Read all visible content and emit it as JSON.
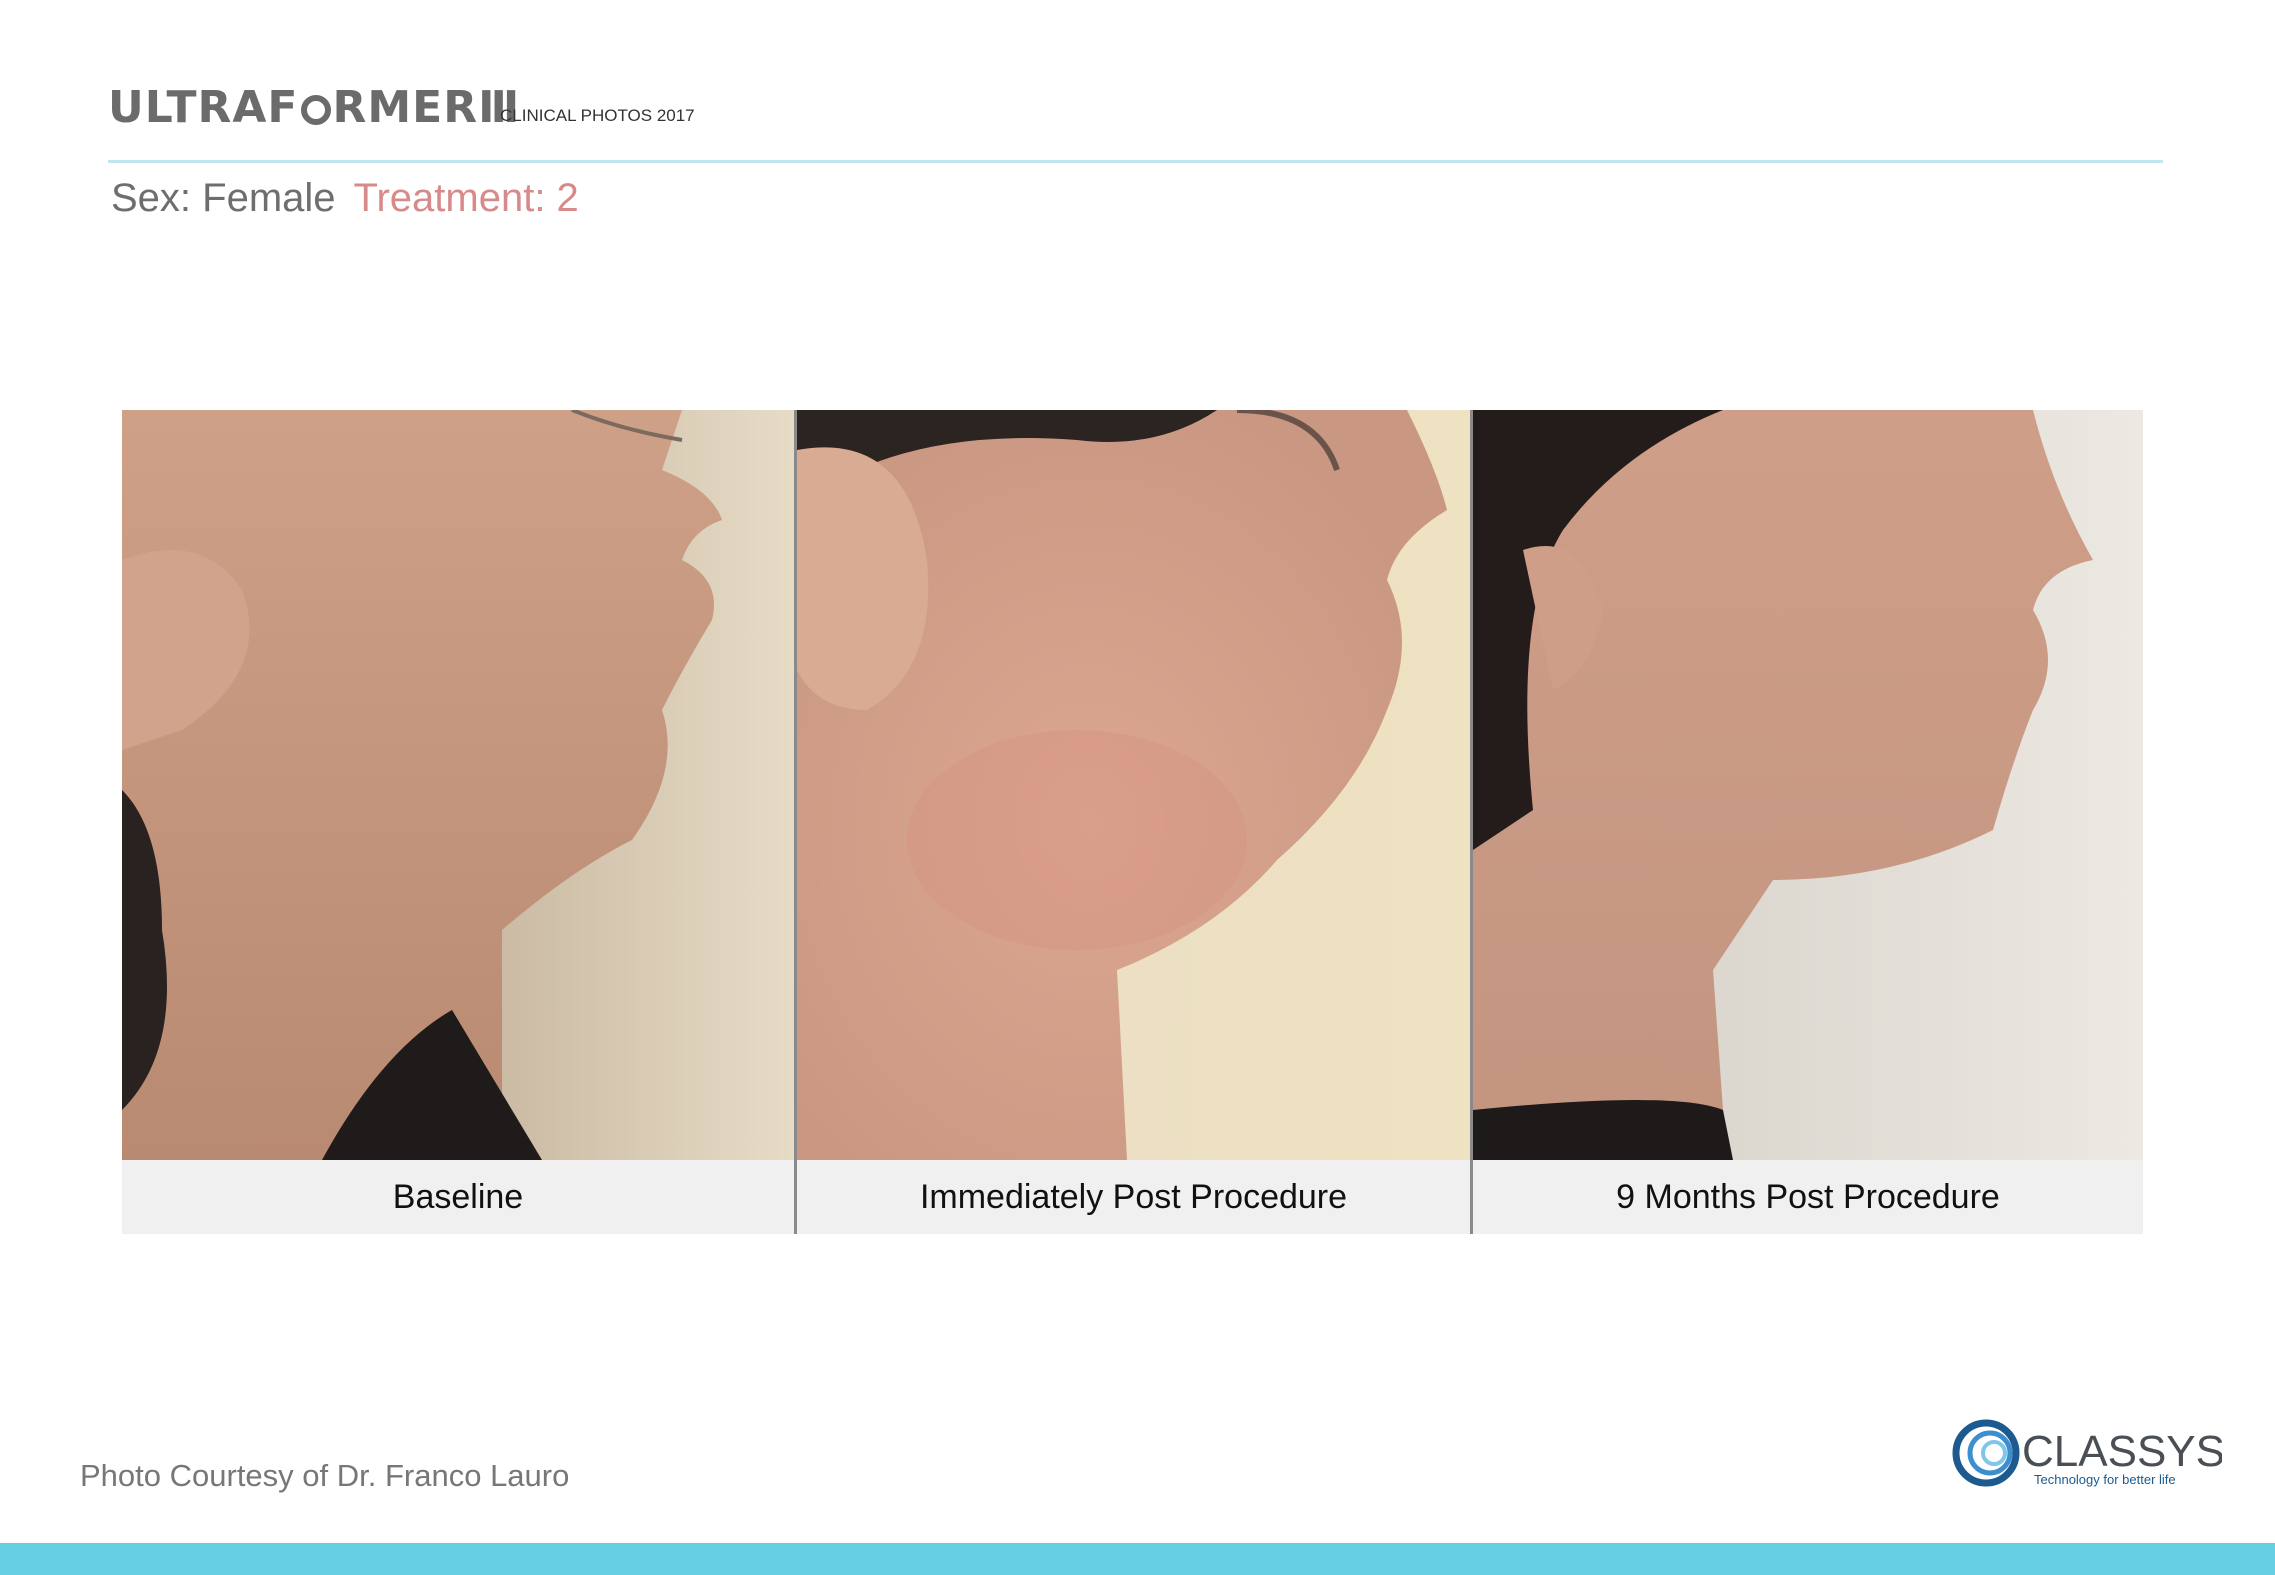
{
  "header": {
    "logo_text_a": "ULTRAF",
    "logo_text_b": "RMER",
    "logo_numeral": "III",
    "subtitle": "CLINICAL PHOTOS 2017"
  },
  "patient": {
    "sex_label": "Sex: Female",
    "treatment_label": "Treatment: 2"
  },
  "panels": [
    {
      "caption": "Baseline"
    },
    {
      "caption": "Immediately Post Procedure"
    },
    {
      "caption": "9 Months Post Procedure"
    }
  ],
  "footer": {
    "credit": "Photo Courtesy of Dr. Franco Lauro",
    "brand_name": "CLASSYS",
    "brand_tagline": "Technology for better life"
  },
  "colors": {
    "accent_bar": "#66cfe2",
    "treatment_text": "#d78a8a",
    "brand_blue": "#1c5a8f"
  }
}
